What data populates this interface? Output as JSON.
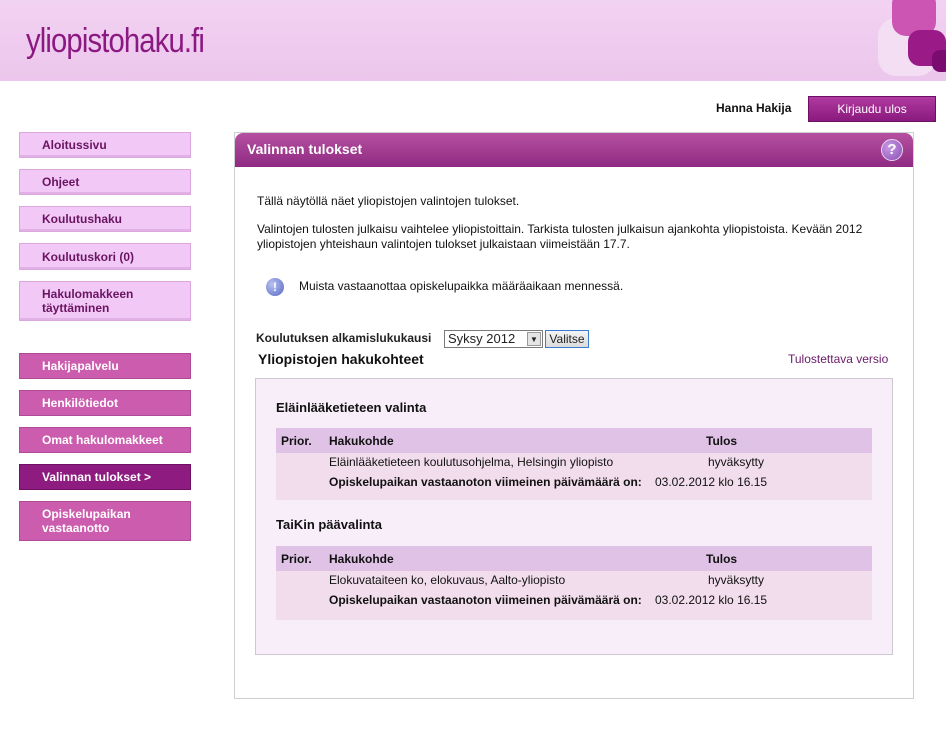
{
  "header": {
    "logo": "yliopistohaku.fi"
  },
  "user": {
    "name": "Hanna Hakija",
    "logout_label": "Kirjaudu ulos"
  },
  "sidebar": {
    "group1": [
      {
        "label": "Aloitussivu"
      },
      {
        "label": "Ohjeet"
      },
      {
        "label": "Koulutushaku"
      },
      {
        "label": "Koulutuskori (0)"
      },
      {
        "label": "Hakulomakkeen täyttäminen"
      }
    ],
    "group2": [
      {
        "label": "Hakijapalvelu"
      },
      {
        "label": "Henkilötiedot"
      },
      {
        "label": "Omat hakulomakkeet"
      },
      {
        "label": "Valinnan tulokset >"
      },
      {
        "label": "Opiskelupaikan vastaanotto"
      }
    ]
  },
  "panel": {
    "title": "Valinnan tulokset",
    "intro": "Tällä näytöllä näet yliopistojen valintojen tulokset.",
    "para_line1": "Valintojen tulosten julkaisu vaihtelee yliopistoittain. Tarkista tulosten julkaisun ajankohta yliopistoista. Kevään 2012",
    "para_line2": "yliopistojen yhteishaun valintojen tulokset julkaistaan viimeistään 17.7.",
    "notice": "Muista vastaanottaa opiskelupaikka määräaikaan mennessä.",
    "select_label": "Koulutuksen alkamislukukausi",
    "select_value": "Syksy 2012",
    "select_button": "Valitse",
    "section_title": "Yliopistojen hakukohteet",
    "print_link": "Tulostettava versio"
  },
  "table_headers": {
    "prior": "Prior.",
    "kohde": "Hakukohde",
    "tulos": "Tulos"
  },
  "groups": [
    {
      "title": "Eläinlääketieteen valinta",
      "kohde": "Eläinlääketieteen koulutusohjelma, Helsingin yliopisto",
      "tulos": "hyväksytty",
      "deadline_label": "Opiskelupaikan vastaanoton viimeinen päivämäärä on:",
      "deadline_value": "03.02.2012 klo 16.15"
    },
    {
      "title": "TaiKin päävalinta",
      "kohde": "Elokuvataiteen ko, elokuvaus, Aalto-yliopisto",
      "tulos": "hyväksytty",
      "deadline_label": "Opiskelupaikan vastaanoton viimeinen päivämäärä on:",
      "deadline_value": "03.02.2012 klo 16.15"
    }
  ],
  "icons": {
    "help": "question-icon",
    "info": "info-icon",
    "select_arrow": "chevron-down-icon"
  }
}
